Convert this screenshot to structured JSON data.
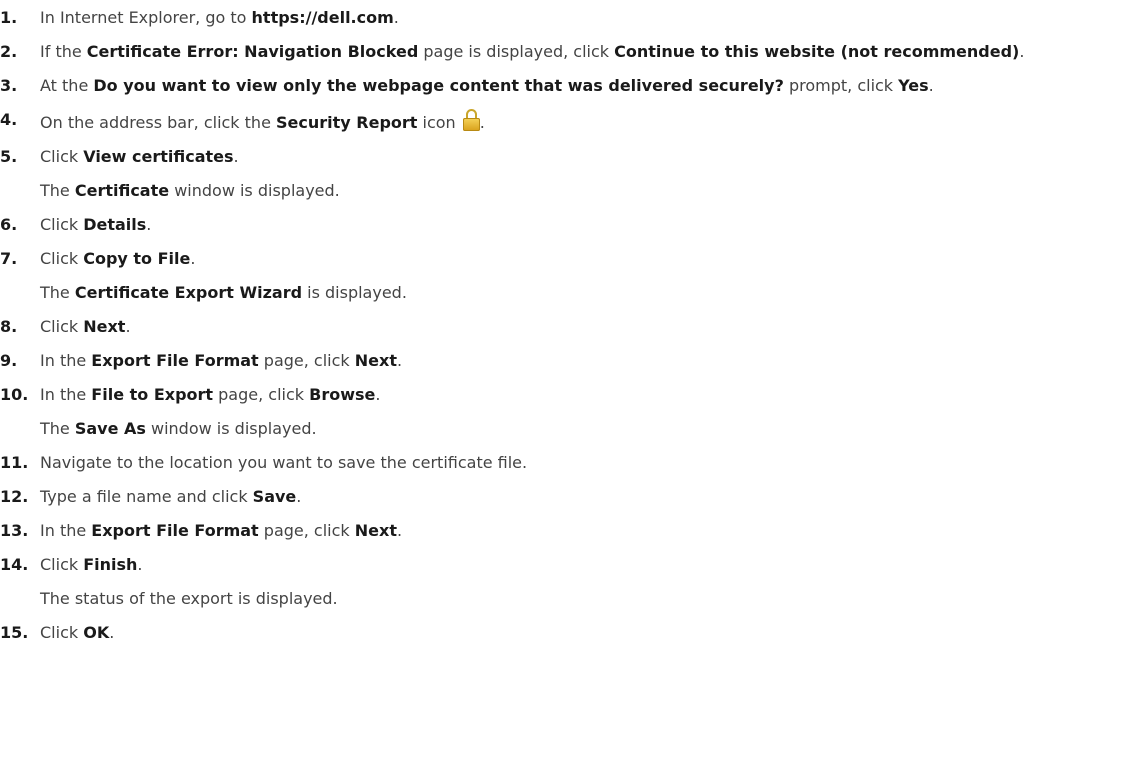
{
  "icons": {
    "security_report": "lock-icon"
  },
  "colors": {
    "text": "#444444",
    "emphasis": "#1a1a1a",
    "lock": "#e6b531"
  },
  "steps": [
    {
      "num": "1.",
      "parts": [
        {
          "t": "In Internet Explorer, go to "
        },
        {
          "t": "https://dell.com",
          "b": true
        },
        {
          "t": "."
        }
      ]
    },
    {
      "num": "2.",
      "parts": [
        {
          "t": "If the "
        },
        {
          "t": "Certificate Error: Navigation Blocked",
          "b": true
        },
        {
          "t": " page is displayed, click "
        },
        {
          "t": "Continue to this website (not recommended)",
          "b": true
        },
        {
          "t": "."
        }
      ]
    },
    {
      "num": "3.",
      "parts": [
        {
          "t": "At the "
        },
        {
          "t": "Do you want to view only the webpage content that was delivered securely?",
          "b": true
        },
        {
          "t": " prompt, click "
        },
        {
          "t": "Yes",
          "b": true
        },
        {
          "t": "."
        }
      ]
    },
    {
      "num": "4.",
      "parts": [
        {
          "t": "On the address bar, click the "
        },
        {
          "t": "Security Report",
          "b": true
        },
        {
          "t": " icon "
        },
        {
          "icon": "lock"
        },
        {
          "t": "."
        }
      ]
    },
    {
      "num": "5.",
      "parts": [
        {
          "t": "Click "
        },
        {
          "t": "View certificates",
          "b": true
        },
        {
          "t": "."
        }
      ],
      "result": [
        {
          "t": "The "
        },
        {
          "t": "Certificate",
          "b": true
        },
        {
          "t": " window is displayed."
        }
      ]
    },
    {
      "num": "6.",
      "parts": [
        {
          "t": "Click "
        },
        {
          "t": "Details",
          "b": true
        },
        {
          "t": "."
        }
      ]
    },
    {
      "num": "7.",
      "parts": [
        {
          "t": "Click "
        },
        {
          "t": "Copy to File",
          "b": true
        },
        {
          "t": "."
        }
      ],
      "result": [
        {
          "t": "The "
        },
        {
          "t": "Certificate Export Wizard",
          "b": true
        },
        {
          "t": " is displayed."
        }
      ]
    },
    {
      "num": "8.",
      "parts": [
        {
          "t": "Click "
        },
        {
          "t": "Next",
          "b": true
        },
        {
          "t": "."
        }
      ]
    },
    {
      "num": "9.",
      "parts": [
        {
          "t": "In the "
        },
        {
          "t": "Export File Format",
          "b": true
        },
        {
          "t": " page, click "
        },
        {
          "t": "Next",
          "b": true
        },
        {
          "t": "."
        }
      ]
    },
    {
      "num": "10.",
      "parts": [
        {
          "t": "In the "
        },
        {
          "t": "File to Export",
          "b": true
        },
        {
          "t": " page, click "
        },
        {
          "t": "Browse",
          "b": true
        },
        {
          "t": "."
        }
      ],
      "result": [
        {
          "t": "The "
        },
        {
          "t": "Save As",
          "b": true
        },
        {
          "t": " window is displayed."
        }
      ]
    },
    {
      "num": "11.",
      "parts": [
        {
          "t": "Navigate to the location you want to save the certificate file."
        }
      ]
    },
    {
      "num": "12.",
      "parts": [
        {
          "t": "Type a file name and click "
        },
        {
          "t": "Save",
          "b": true
        },
        {
          "t": "."
        }
      ]
    },
    {
      "num": "13.",
      "parts": [
        {
          "t": "In the "
        },
        {
          "t": "Export File Format",
          "b": true
        },
        {
          "t": " page, click "
        },
        {
          "t": "Next",
          "b": true
        },
        {
          "t": "."
        }
      ]
    },
    {
      "num": "14.",
      "parts": [
        {
          "t": "Click "
        },
        {
          "t": "Finish",
          "b": true
        },
        {
          "t": "."
        }
      ],
      "result": [
        {
          "t": "The status of the export is displayed."
        }
      ]
    },
    {
      "num": "15.",
      "parts": [
        {
          "t": "Click "
        },
        {
          "t": "OK",
          "b": true
        },
        {
          "t": "."
        }
      ]
    }
  ]
}
